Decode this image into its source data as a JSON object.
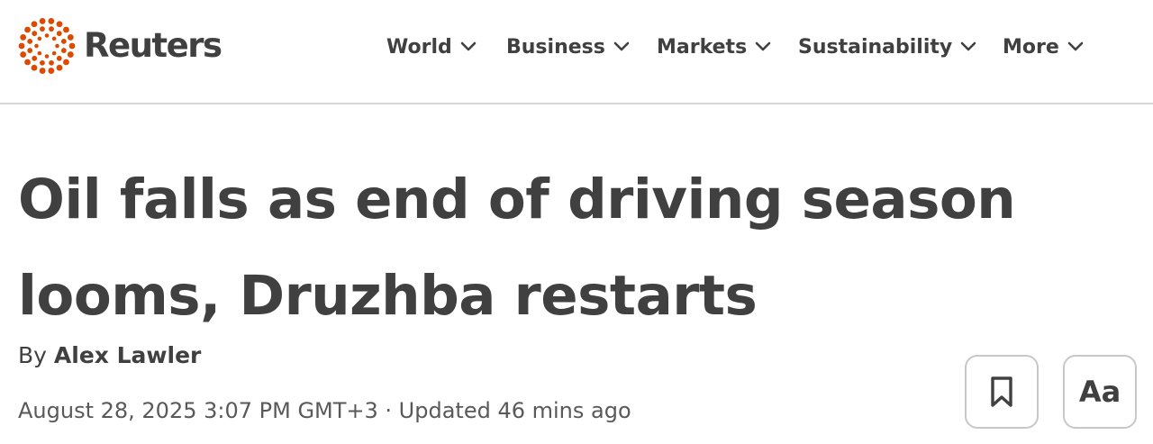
{
  "brand": {
    "name": "Reuters",
    "logo_color": "#dc4a00"
  },
  "nav": {
    "items": [
      {
        "label": "World",
        "icon": "chevron-down-icon"
      },
      {
        "label": "Business",
        "icon": "chevron-down-icon"
      },
      {
        "label": "Markets",
        "icon": "chevron-down-icon"
      },
      {
        "label": "Sustainability",
        "icon": "chevron-down-icon"
      },
      {
        "label": "More",
        "icon": "chevron-down-icon"
      }
    ]
  },
  "article": {
    "headline": "Oil falls as end of driving season looms, Druzhba restarts",
    "byline_prefix": "By",
    "author": "Alex Lawler",
    "dateline": "August 28, 2025 3:07 PM GMT+3 · Updated 46 mins ago"
  },
  "tools": {
    "bookmark_icon": "bookmark-icon",
    "font_size_label": "Aa"
  },
  "colors": {
    "text": "#404040",
    "divider": "#d6d6d6",
    "button_border": "#c8c8c8"
  }
}
